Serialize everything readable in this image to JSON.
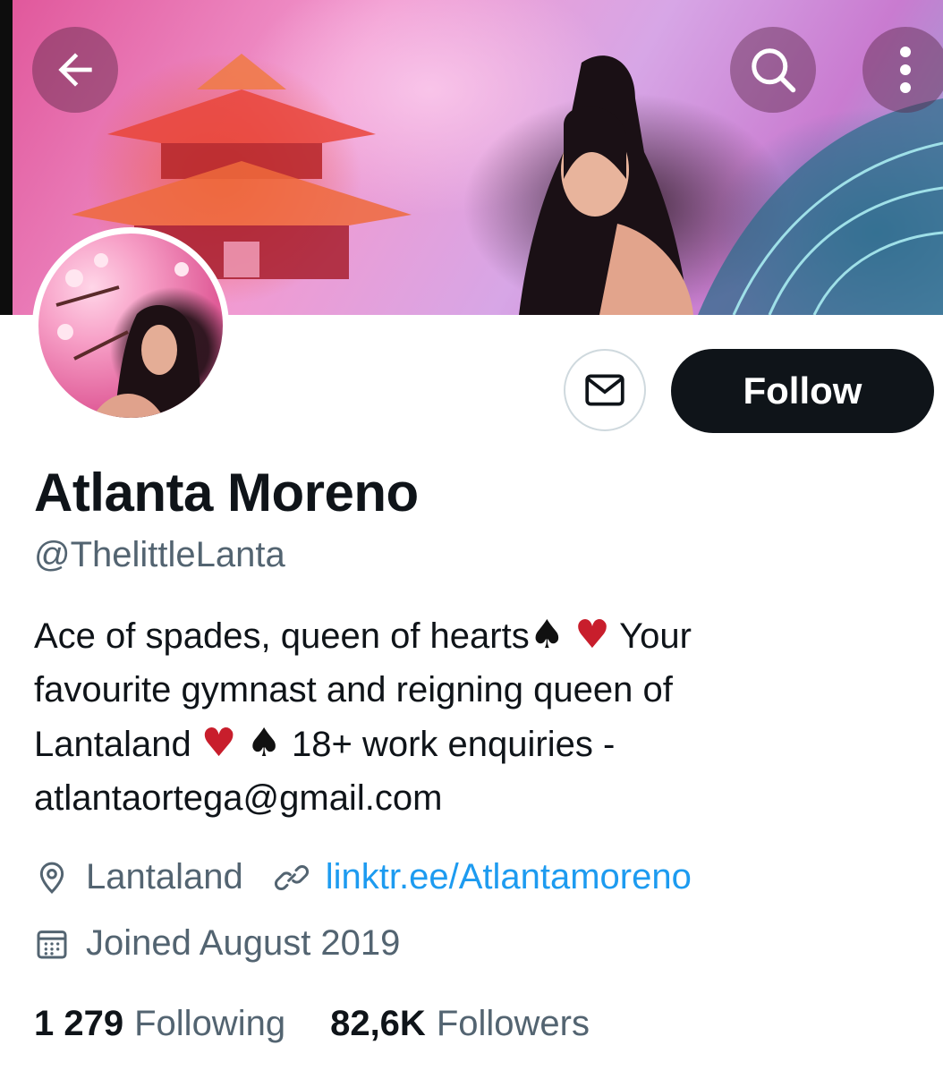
{
  "header": {
    "back_icon": "arrow-left-icon",
    "search_icon": "search-icon",
    "more_icon": "more-vertical-icon"
  },
  "profile": {
    "display_name": "Atlanta Moreno",
    "handle": "@ThelittleLanta",
    "bio": {
      "line1_text": "Ace of spades, queen of hearts",
      "line1_tail": "Your",
      "line2": "favourite gymnast and reigning queen of",
      "line3_start": "Lantaland",
      "line3_end": "18+ work enquiries -",
      "line4": "atlantaortega@gmail.com",
      "spade": "♠",
      "heart": "♥"
    },
    "location": "Lantaland",
    "website": "linktr.ee/Atlantamoreno",
    "joined": "Joined August 2019"
  },
  "actions": {
    "follow_label": "Follow",
    "message_icon": "mail-icon"
  },
  "stats": {
    "following_count": "1 279",
    "following_label": "Following",
    "followers_count": "82,6K",
    "followers_label": "Followers"
  },
  "colors": {
    "text_primary": "#0f1419",
    "text_secondary": "#536471",
    "link": "#1d9bf0",
    "follow_bg": "#0f1419",
    "heart": "#c81e2c"
  }
}
